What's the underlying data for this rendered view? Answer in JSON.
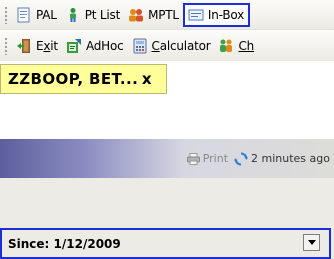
{
  "toolbar_top": {
    "items": [
      {
        "label": "PAL",
        "icon": "document-icon"
      },
      {
        "label": "Pt List",
        "icon": "person-icon"
      },
      {
        "label": "MPTL",
        "icon": "group-icon"
      },
      {
        "label": "In-Box",
        "icon": "inbox-icon",
        "active": true
      }
    ]
  },
  "toolbar_bottom": {
    "items": [
      {
        "label_prefix": "E",
        "label_underlined": "x",
        "label_suffix": "it",
        "icon": "exit-door-icon"
      },
      {
        "label_prefix": "",
        "label_underlined": "",
        "label_suffix": "AdHoc",
        "icon": "adhoc-icon"
      },
      {
        "label_prefix": "",
        "label_underlined": "C",
        "label_suffix": "alculator",
        "icon": "calculator-icon"
      },
      {
        "label_prefix": "",
        "label_underlined": "Ch",
        "label_suffix": "",
        "icon": "people-icon"
      }
    ]
  },
  "patient_tab": {
    "name": "ZZBOOP, BET...",
    "close": "x"
  },
  "header_bar": {
    "print_label": "Print",
    "updated_label": "2 minutes ago"
  },
  "filter": {
    "since_label": "Since: 1/12/2009"
  },
  "colors": {
    "accent_border": "#1a2fd6",
    "patient_tab_bg": "#ffff99"
  }
}
